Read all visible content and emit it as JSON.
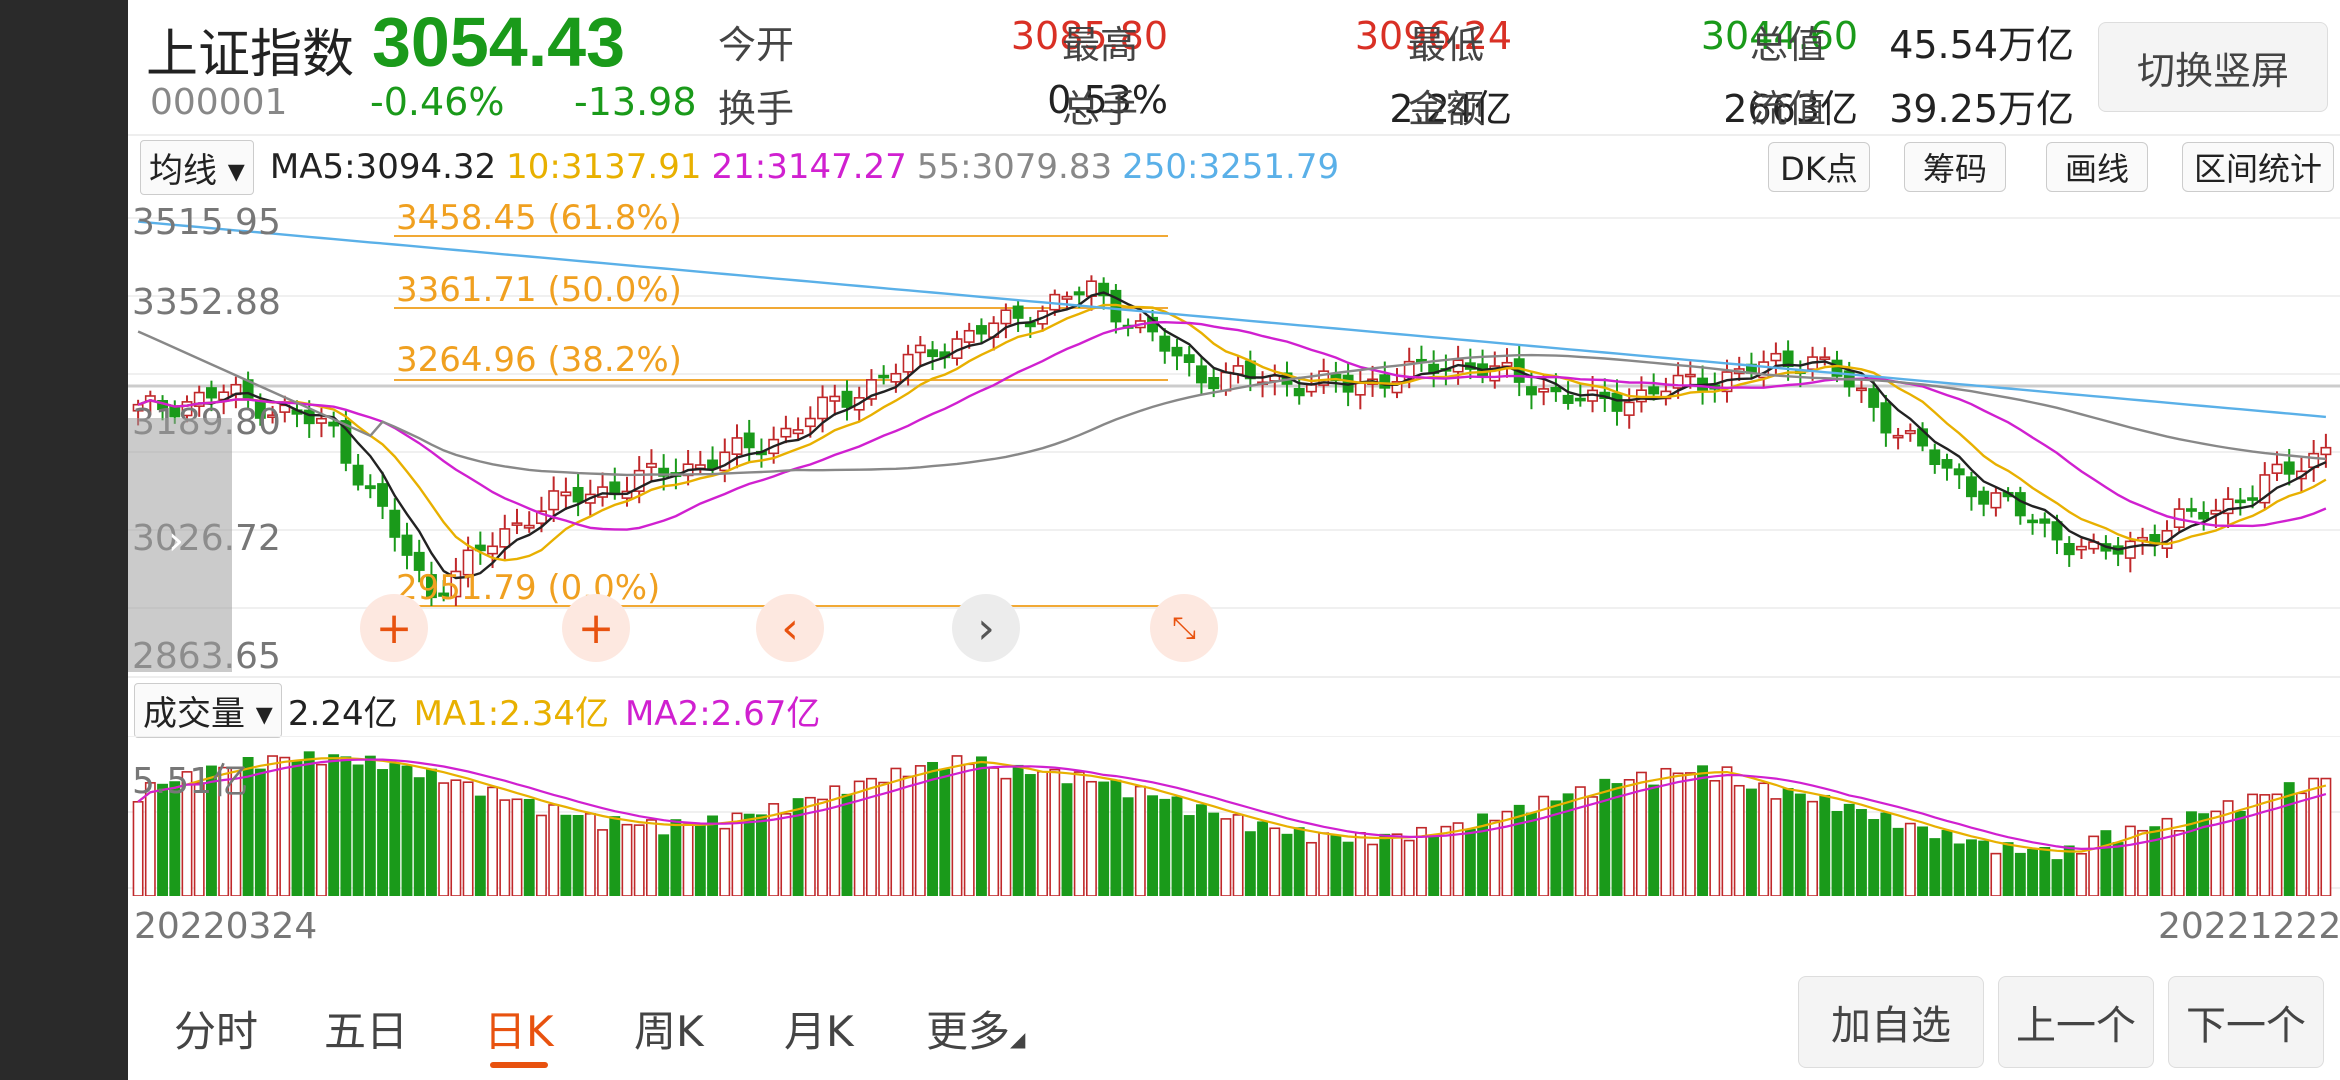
{
  "header": {
    "name": "上证指数",
    "price": "3054.43",
    "code": "000001",
    "change_pct": "-0.46%",
    "change_abs": "-13.98",
    "stats_row1": [
      {
        "label": "今开",
        "value": "3085.80",
        "color": "red"
      },
      {
        "label": "最高",
        "value": "3096.24",
        "color": "red"
      },
      {
        "label": "最低",
        "value": "3044.60",
        "color": "green"
      },
      {
        "label": "总值",
        "value": "45.54万亿",
        "color": "dark"
      }
    ],
    "stats_row2": [
      {
        "label": "换手",
        "value": "0.53%",
        "color": "dark"
      },
      {
        "label": "总手",
        "value": "2.24亿",
        "color": "dark"
      },
      {
        "label": "金额",
        "value": "2663亿",
        "color": "dark"
      },
      {
        "label": "流值",
        "value": "39.25万亿",
        "color": "dark"
      }
    ],
    "switch_button": "切换竖屏"
  },
  "ma_bar": {
    "dropdown": "均线",
    "items": [
      {
        "text": "MA5:3094.32",
        "color": "#222222"
      },
      {
        "text": "10:3137.91",
        "color": "#e8b000"
      },
      {
        "text": "21:3147.27",
        "color": "#d020d0"
      },
      {
        "text": "55:3079.83",
        "color": "#888888"
      },
      {
        "text": "250:3251.79",
        "color": "#5ab0e8"
      }
    ],
    "tools": [
      "DK点",
      "筹码",
      "画线",
      "区间统计"
    ]
  },
  "price_chart": {
    "y_ticks": [
      "3515.95",
      "3352.88",
      "3189.80",
      "3026.72",
      "2863.65"
    ],
    "fib_levels": [
      {
        "label": "3458.45 (61.8%)"
      },
      {
        "label": "3361.71 (50.0%)"
      },
      {
        "label": "3264.96 (38.2%)"
      },
      {
        "label": "2951.79 (0.0%)"
      }
    ]
  },
  "volume_bar": {
    "dropdown": "成交量",
    "value": "2.24亿",
    "ma1": "MA1:2.34亿",
    "ma2": "MA2:2.67亿",
    "max_label": "5.51亿"
  },
  "x_axis": {
    "start": "20220324",
    "end": "20221222"
  },
  "tabs": [
    {
      "label": "分时",
      "active": false
    },
    {
      "label": "五日",
      "active": false
    },
    {
      "label": "日K",
      "active": true
    },
    {
      "label": "周K",
      "active": false
    },
    {
      "label": "月K",
      "active": false
    },
    {
      "label": "更多",
      "active": false
    }
  ],
  "bottom_buttons": [
    "加自选",
    "上一个",
    "下一个"
  ],
  "colors": {
    "up": "#c0282a",
    "down": "#1a9a1a",
    "fib": "#f0a020",
    "accent": "#e8520f"
  }
}
